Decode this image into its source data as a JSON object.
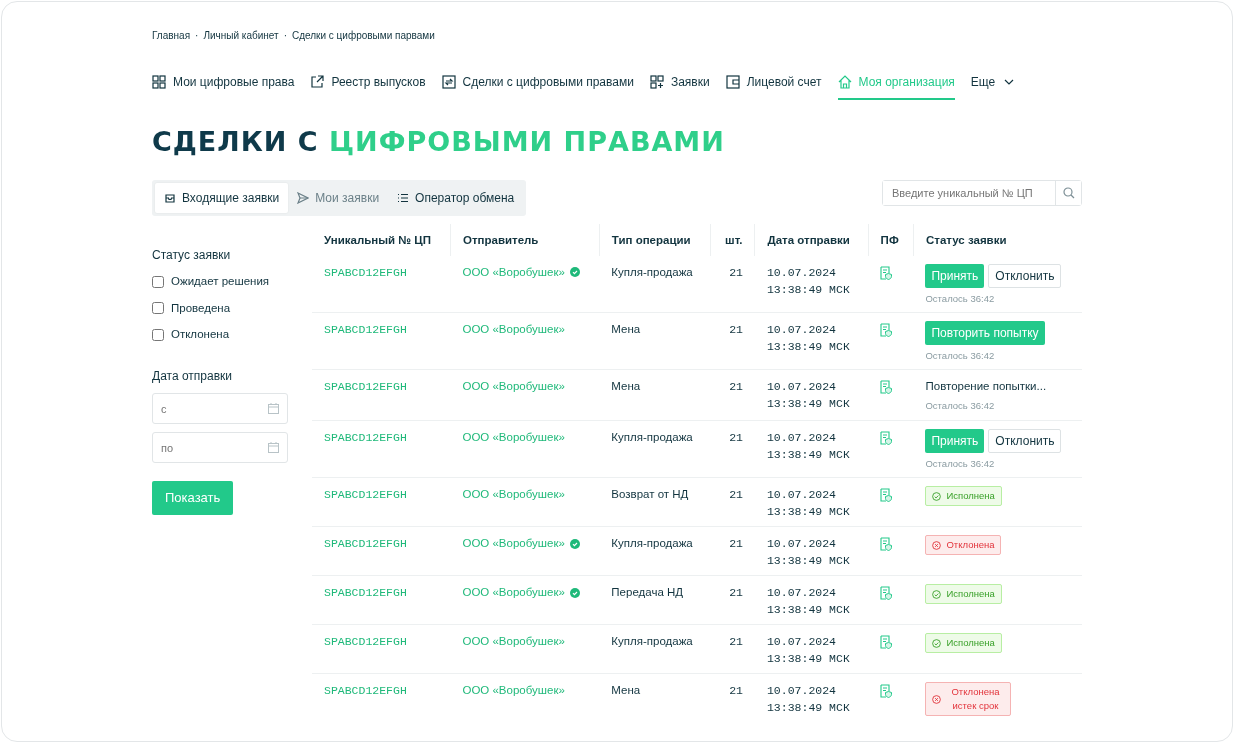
{
  "breadcrumbs": {
    "separator": "·",
    "items": [
      "Главная",
      "Личный кабинет",
      "Сделки с цифровыми парвами"
    ]
  },
  "nav": [
    {
      "label": "Мои цифровые права",
      "selected": false
    },
    {
      "label": "Реестр выпусков",
      "selected": false
    },
    {
      "label": "Сделки с цифровыми правами",
      "selected": false
    },
    {
      "label": "Заявки",
      "selected": false
    },
    {
      "label": "Лицевой счет",
      "selected": false
    },
    {
      "label": "Моя организация",
      "selected": true
    },
    {
      "label": "Еще",
      "selected": false
    }
  ],
  "title": {
    "text": "СДЕЛКИ С",
    "highlight": "ЦИФРОВЫМИ ПРАВАМИ"
  },
  "tabs": [
    {
      "label": "Входящие заявки",
      "selected": true
    },
    {
      "label": "Мои заявки",
      "selected": false
    },
    {
      "label": "Оператор обмена",
      "selected": false
    }
  ],
  "search": {
    "placeholder": "Введите уникальный № ЦП"
  },
  "filters": {
    "status_title": "Статус заявки",
    "statuses": [
      {
        "label": "Ожидает решения",
        "checked": false
      },
      {
        "label": "Проведена",
        "checked": false
      },
      {
        "label": "Отклонена",
        "checked": false
      }
    ],
    "date_title": "Дата отправки",
    "date_from": {
      "placeholder": "с"
    },
    "date_to": {
      "placeholder": "по"
    },
    "submit": "Показать"
  },
  "table": {
    "columns": [
      "Уникальный № ЦП",
      "Отправитель",
      "Тип операции",
      "шт.",
      "Дата отправки",
      "ПФ",
      "Статус заявки"
    ],
    "rows": [
      {
        "id": "SPABCD12EFGH",
        "sender": "ООО «Воробушек»",
        "verified": true,
        "operation": "Купля-продажа",
        "qty": "21",
        "date": "10.07.2024",
        "time": "13:38:49  МСК",
        "status": {
          "kind": "actions",
          "accept": "Принять",
          "reject": "Отклонить",
          "remaining": "Осталось 36:42"
        }
      },
      {
        "id": "SPABCD12EFGH",
        "sender": "ООО «Воробушек»",
        "verified": false,
        "operation": "Мена",
        "qty": "21",
        "date": "10.07.2024",
        "time": "13:38:49  МСК",
        "status": {
          "kind": "retry",
          "button": "Повторить попытку",
          "remaining": "Осталось 36:42"
        }
      },
      {
        "id": "SPABCD12EFGH",
        "sender": "ООО «Воробушек»",
        "verified": false,
        "operation": "Мена",
        "qty": "21",
        "date": "10.07.2024",
        "time": "13:38:49  МСК",
        "status": {
          "kind": "pending",
          "text": "Повторение попытки...",
          "remaining": "Осталось 36:42"
        }
      },
      {
        "id": "SPABCD12EFGH",
        "sender": "ООО «Воробушек»",
        "verified": false,
        "operation": "Купля-продажа",
        "qty": "21",
        "date": "10.07.2024",
        "time": "13:38:49  МСК",
        "status": {
          "kind": "actions",
          "accept": "Принять",
          "reject": "Отклонить",
          "remaining": "Осталось 36:42"
        }
      },
      {
        "id": "SPABCD12EFGH",
        "sender": "ООО «Воробушек»",
        "verified": false,
        "operation": "Возврат от НД",
        "qty": "21",
        "date": "10.07.2024",
        "time": "13:38:49  МСК",
        "status": {
          "kind": "success",
          "text": "Исполнена"
        }
      },
      {
        "id": "SPABCD12EFGH",
        "sender": "ООО «Воробушек»",
        "verified": true,
        "operation": "Купля-продажа",
        "qty": "21",
        "date": "10.07.2024",
        "time": "13:38:49  МСК",
        "status": {
          "kind": "danger",
          "text": "Отклонена"
        }
      },
      {
        "id": "SPABCD12EFGH",
        "sender": "ООО «Воробушек»",
        "verified": true,
        "operation": "Передача НД",
        "qty": "21",
        "date": "10.07.2024",
        "time": "13:38:49  МСК",
        "status": {
          "kind": "success",
          "text": "Исполнена"
        }
      },
      {
        "id": "SPABCD12EFGH",
        "sender": "ООО «Воробушек»",
        "verified": false,
        "operation": "Купля-продажа",
        "qty": "21",
        "date": "10.07.2024",
        "time": "13:38:49  МСК",
        "status": {
          "kind": "success",
          "text": "Исполнена"
        }
      },
      {
        "id": "SPABCD12EFGH",
        "sender": "ООО «Воробушек»",
        "verified": false,
        "operation": "Мена",
        "qty": "21",
        "date": "10.07.2024",
        "time": "13:38:49  МСК",
        "status": {
          "kind": "danger",
          "text": "Отклонена истек срок"
        }
      }
    ]
  }
}
